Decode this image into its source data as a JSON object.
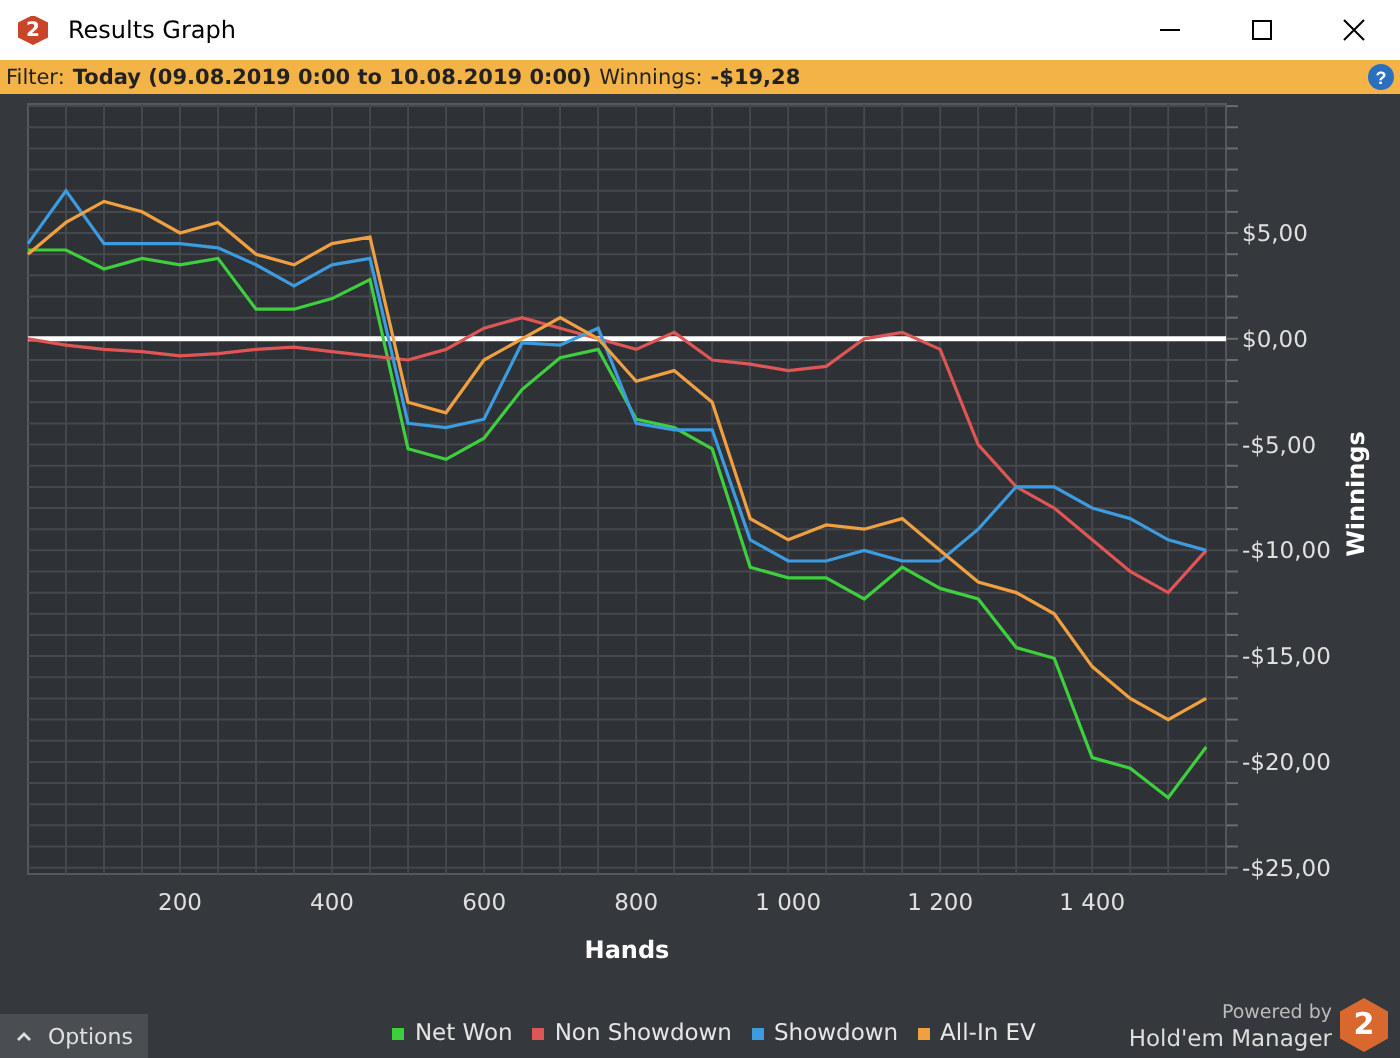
{
  "window": {
    "title": "Results Graph",
    "icon_mark": "2"
  },
  "filter_bar": {
    "label": "Filter:",
    "filter": "Today (09.08.2019 0:00 to 10.08.2019 0:00)",
    "winnings_label": "Winnings:",
    "winnings": "-$19,28",
    "help": "?"
  },
  "chart": {
    "chart_data": {
      "type": "line",
      "grid": true,
      "xlabel": "Hands",
      "ylabel": "Winnings",
      "xlim": [
        0,
        1576
      ],
      "ylim": [
        -25.3,
        11.1
      ],
      "xticks": [
        {
          "value": 200,
          "label": "200"
        },
        {
          "value": 400,
          "label": "400"
        },
        {
          "value": 600,
          "label": "600"
        },
        {
          "value": 800,
          "label": "800"
        },
        {
          "value": 1000,
          "label": "1 000"
        },
        {
          "value": 1200,
          "label": "1 200"
        },
        {
          "value": 1400,
          "label": "1 400"
        }
      ],
      "yticks": [
        {
          "value": 5,
          "label": "$5,00"
        },
        {
          "value": 0,
          "label": "$0,00"
        },
        {
          "value": -5,
          "label": "-$5,00"
        },
        {
          "value": -10,
          "label": "-$10,00"
        },
        {
          "value": -15,
          "label": "-$15,00"
        },
        {
          "value": -20,
          "label": "-$20,00"
        },
        {
          "value": -25,
          "label": "-$25,00"
        }
      ],
      "x": [
        0,
        50,
        100,
        150,
        200,
        250,
        300,
        350,
        400,
        450,
        500,
        550,
        600,
        650,
        700,
        750,
        800,
        850,
        900,
        950,
        1000,
        1050,
        1100,
        1150,
        1200,
        1250,
        1300,
        1350,
        1400,
        1450,
        1500,
        1550
      ],
      "series": [
        {
          "name": "Net Won",
          "color": "#3ecf3e",
          "values": [
            4.2,
            4.2,
            3.3,
            3.8,
            3.5,
            3.8,
            1.4,
            1.4,
            1.9,
            2.8,
            -5.2,
            -5.7,
            -4.7,
            -2.4,
            -0.9,
            -0.5,
            -3.8,
            -4.2,
            -5.2,
            -10.8,
            -11.3,
            -11.3,
            -12.3,
            -10.8,
            -11.8,
            -12.3,
            -14.6,
            -15.1,
            -19.8,
            -20.3,
            -21.7,
            -19.3
          ]
        },
        {
          "name": "Non Showdown",
          "color": "#e05555",
          "values": [
            0,
            -0.3,
            -0.5,
            -0.6,
            -0.8,
            -0.7,
            -0.5,
            -0.4,
            -0.6,
            -0.8,
            -1,
            -0.5,
            0.5,
            1,
            0.5,
            0,
            -0.5,
            0.3,
            -1,
            -1.2,
            -1.5,
            -1.3,
            0,
            0.3,
            -0.5,
            -5,
            -7,
            -8,
            -9.5,
            -11,
            -12,
            -10
          ]
        },
        {
          "name": "Showdown",
          "color": "#3d9be0",
          "values": [
            4.5,
            7,
            4.5,
            4.5,
            4.5,
            4.3,
            3.5,
            2.5,
            3.5,
            3.8,
            -4,
            -4.2,
            -3.8,
            -0.2,
            -0.3,
            0.5,
            -4,
            -4.3,
            -4.3,
            -9.5,
            -10.5,
            -10.5,
            -10,
            -10.5,
            -10.5,
            -9,
            -7,
            -7,
            -8,
            -8.5,
            -9.5,
            -10
          ]
        },
        {
          "name": "All-In EV",
          "color": "#f0a040",
          "values": [
            4,
            5.5,
            6.5,
            6,
            5,
            5.5,
            4,
            3.5,
            4.5,
            4.8,
            -3,
            -3.5,
            -1,
            0,
            1,
            0,
            -2,
            -1.5,
            -3,
            -8.5,
            -9.5,
            -8.8,
            -9,
            -8.5,
            -10,
            -11.5,
            -12,
            -13,
            -15.5,
            -17,
            -18,
            -17
          ]
        }
      ]
    }
  },
  "footer": {
    "options": "Options",
    "powered_by": "Powered by",
    "brand": "Hold'em Manager",
    "logo_mark": "2"
  }
}
